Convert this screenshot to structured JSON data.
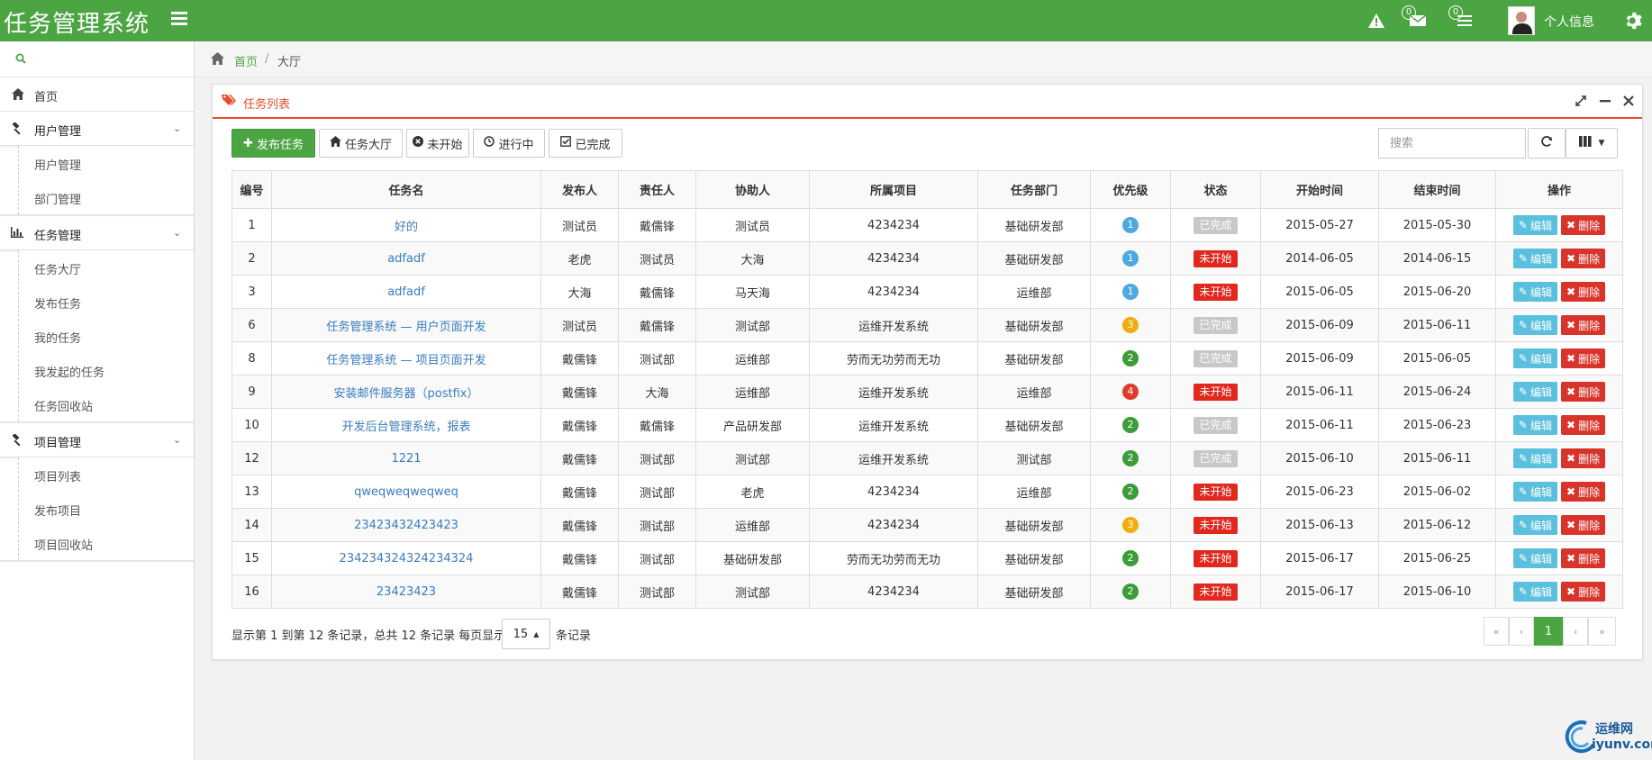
{
  "app": {
    "title": "任务管理系统",
    "user_label": "个人信息",
    "mail_count": "0",
    "task_count": "0"
  },
  "sidebar": {
    "home": "首页",
    "groups": [
      {
        "label": "用户管理",
        "items": [
          "用户管理",
          "部门管理"
        ]
      },
      {
        "label": "任务管理",
        "items": [
          "任务大厅",
          "发布任务",
          "我的任务",
          "我发起的任务",
          "任务回收站"
        ]
      },
      {
        "label": "项目管理",
        "items": [
          "项目列表",
          "发布项目",
          "项目回收站"
        ]
      }
    ]
  },
  "breadcrumb": {
    "home": "首页",
    "sep": "/",
    "current": "大厅"
  },
  "panel": {
    "title": "任务列表"
  },
  "toolbar": {
    "publish": "发布任务",
    "hall": "任务大厅",
    "not_started": "未开始",
    "in_progress": "进行中",
    "done": "已完成",
    "search_placeholder": "搜索"
  },
  "table": {
    "headers": [
      "编号",
      "任务名",
      "发布人",
      "责任人",
      "协助人",
      "所属项目",
      "任务部门",
      "优先级",
      "状态",
      "开始时间",
      "结束时间",
      "操作"
    ],
    "edit_label": "编辑",
    "delete_label": "删除",
    "rows": [
      [
        "1",
        "好的",
        "测试员",
        "戴儒锋",
        "测试员",
        "4234234",
        "基础研发部",
        "1",
        "已完成",
        "2015-05-27",
        "2015-05-30"
      ],
      [
        "2",
        "adfadf",
        "老虎",
        "测试员",
        "大海",
        "4234234",
        "基础研发部",
        "1",
        "未开始",
        "2014-06-05",
        "2014-06-15"
      ],
      [
        "3",
        "adfadf",
        "大海",
        "戴儒锋",
        "马天海",
        "4234234",
        "运维部",
        "1",
        "未开始",
        "2015-06-05",
        "2015-06-20"
      ],
      [
        "6",
        "任务管理系统 — 用户页面开发",
        "测试员",
        "戴儒锋",
        "测试部",
        "运维开发系统",
        "基础研发部",
        "3",
        "已完成",
        "2015-06-09",
        "2015-06-11"
      ],
      [
        "8",
        "任务管理系统 — 项目页面开发",
        "戴儒锋",
        "测试部",
        "运维部",
        "劳而无功劳而无功",
        "基础研发部",
        "2",
        "已完成",
        "2015-06-09",
        "2015-06-05"
      ],
      [
        "9",
        "安装邮件服务器（postfix）",
        "戴儒锋",
        "大海",
        "运维部",
        "运维开发系统",
        "运维部",
        "4",
        "未开始",
        "2015-06-11",
        "2015-06-24"
      ],
      [
        "10",
        "开发后台管理系统，报表",
        "戴儒锋",
        "戴儒锋",
        "产品研发部",
        "运维开发系统",
        "基础研发部",
        "2",
        "已完成",
        "2015-06-11",
        "2015-06-23"
      ],
      [
        "12",
        "1221",
        "戴儒锋",
        "测试部",
        "测试部",
        "运维开发系统",
        "测试部",
        "2",
        "已完成",
        "2015-06-10",
        "2015-06-11"
      ],
      [
        "13",
        "qweqweqweqweq",
        "戴儒锋",
        "测试部",
        "老虎",
        "4234234",
        "运维部",
        "2",
        "未开始",
        "2015-06-23",
        "2015-06-02"
      ],
      [
        "14",
        "23423432423423",
        "戴儒锋",
        "测试部",
        "运维部",
        "4234234",
        "基础研发部",
        "3",
        "未开始",
        "2015-06-13",
        "2015-06-12"
      ],
      [
        "15",
        "234234324324234324",
        "戴儒锋",
        "测试部",
        "基础研发部",
        "劳而无功劳而无功",
        "基础研发部",
        "2",
        "未开始",
        "2015-06-17",
        "2015-06-25"
      ],
      [
        "16",
        "23423423",
        "戴儒锋",
        "测试部",
        "测试部",
        "4234234",
        "基础研发部",
        "2",
        "未开始",
        "2015-06-17",
        "2015-06-10"
      ]
    ]
  },
  "footer": {
    "info": "显示第 1 到第 12 条记录，总共 12 条记录 每页显示",
    "page_size": "15",
    "info_suffix": "条记录",
    "pager": {
      "first": "«",
      "prev": "‹",
      "current": "1",
      "next": "›",
      "last": "»"
    }
  },
  "watermark": {
    "line1": "运维网",
    "line2": "iyunv.com"
  },
  "colors": {
    "brand_green": "#4ca543",
    "accent_red": "#e74c2e",
    "link_blue": "#3a7cc0",
    "edit_blue": "#5bc0de",
    "delete_red": "#d9342b",
    "status_done": "#c8c8c8",
    "status_not_started": "#e0281f",
    "priority": {
      "1": "#4fa9e0",
      "2": "#3c9c3a",
      "3": "#f0ad0e",
      "4": "#dd3c2b"
    }
  }
}
